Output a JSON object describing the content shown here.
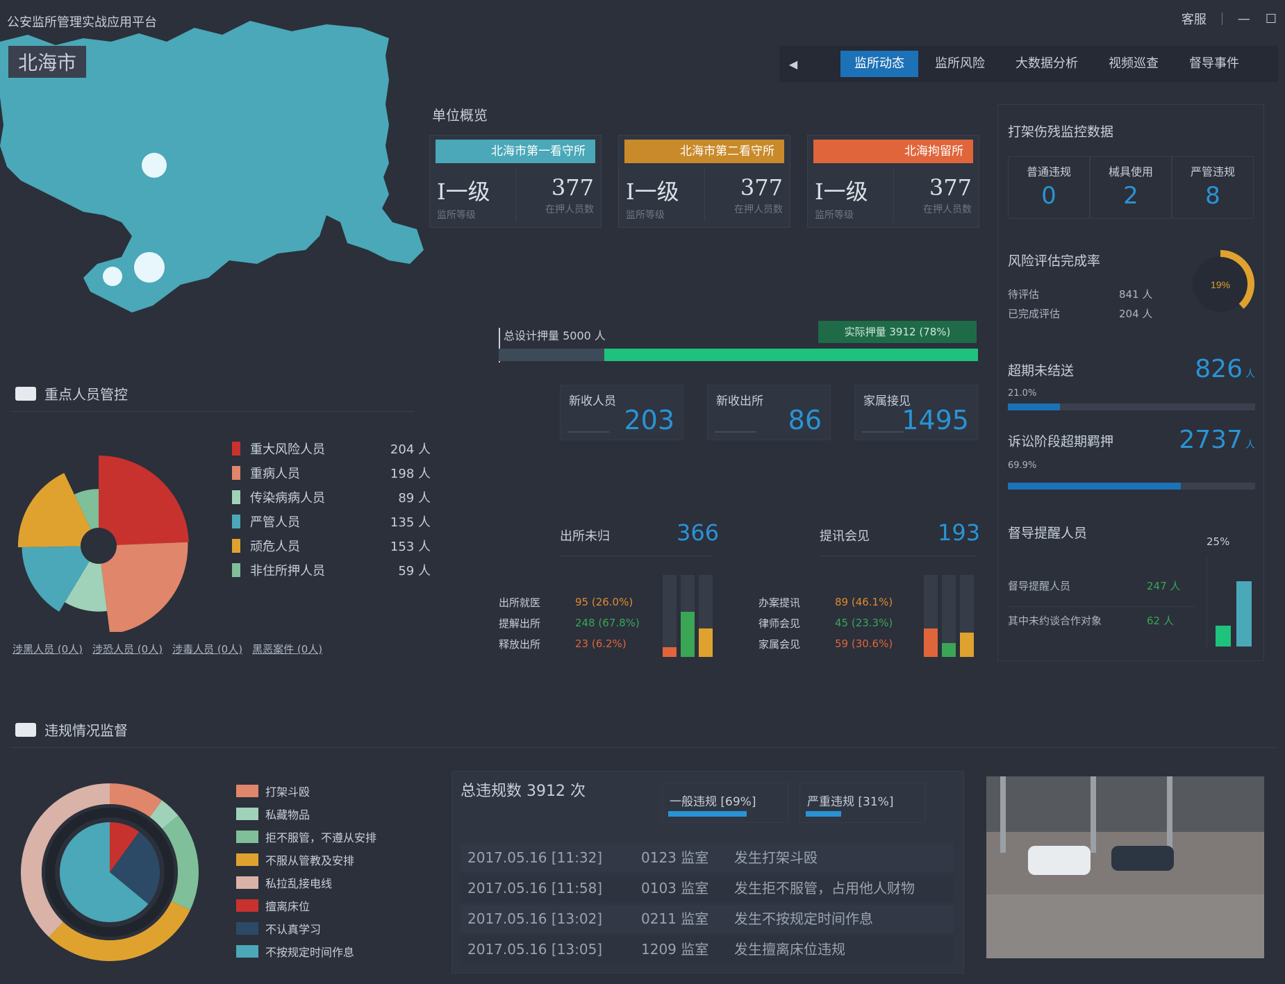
{
  "app": {
    "title": "公安监所管理实战应用平台",
    "city": "北海市"
  },
  "window": {
    "controls": [
      "客服",
      "|",
      "—",
      "☐"
    ]
  },
  "nav": {
    "arrow": "◀",
    "tabs": [
      "监所动态",
      "监所风险",
      "大数据分析",
      "视频巡查",
      "督导事件"
    ],
    "active_index": 0
  },
  "overview": {
    "title": "单位概览",
    "cards": [
      {
        "name": "北海市第一看守所",
        "color": "#4aa8b8",
        "level": "I一级",
        "level_label": "监所等级",
        "count": "377",
        "count_label": "在押人员数"
      },
      {
        "name": "北海市第二看守所",
        "color": "#c88a2a",
        "level": "I一级",
        "level_label": "监所等级",
        "count": "377",
        "count_label": "在押人员数"
      },
      {
        "name": "北海拘留所",
        "color": "#e0653a",
        "level": "I一级",
        "level_label": "监所等级",
        "count": "377",
        "count_label": "在押人员数"
      }
    ]
  },
  "progress": {
    "label": "总设计押量 5000 人",
    "badge": "实际押量 3912 (78%)",
    "fraction": 0.78
  },
  "stats": [
    {
      "label": "新收人员",
      "value": "203"
    },
    {
      "label": "新收出所",
      "value": "86"
    },
    {
      "label": "家属接见",
      "value": "1495"
    }
  ],
  "subpanels": [
    {
      "title": "出所未归",
      "value": "366",
      "rows": [
        {
          "k": "出所就医",
          "v": "95 (26.0%)",
          "color": "#e08a2f"
        },
        {
          "k": "提解出所",
          "v": "248 (67.8%)",
          "color": "#3aa655"
        },
        {
          "k": "释放出所",
          "v": "23 (6.2%)",
          "color": "#e0653a"
        }
      ],
      "bars": [
        {
          "value": 0.12,
          "color": "#e0653a"
        },
        {
          "value": 0.55,
          "color": "#3aa655"
        },
        {
          "value": 0.35,
          "color": "#e0a22f"
        }
      ]
    },
    {
      "title": "提讯会见",
      "value": "193",
      "rows": [
        {
          "k": "办案提讯",
          "v": "89 (46.1%)",
          "color": "#e08a2f"
        },
        {
          "k": "律师会见",
          "v": "45 (23.3%)",
          "color": "#3aa655"
        },
        {
          "k": "家属会见",
          "v": "59 (30.6%)",
          "color": "#e0653a"
        }
      ],
      "bars": [
        {
          "value": 0.35,
          "color": "#e0653a"
        },
        {
          "value": 0.17,
          "color": "#3aa655"
        },
        {
          "value": 0.3,
          "color": "#e0a22f"
        }
      ]
    }
  ],
  "right": {
    "supervision": {
      "title": "打架伤残监控数据",
      "items": [
        {
          "label": "普通违规",
          "value": "0"
        },
        {
          "label": "械具使用",
          "value": "2"
        },
        {
          "label": "严管违规",
          "value": "8"
        }
      ]
    },
    "risk": {
      "title": "风险评估完成率",
      "rows": [
        {
          "k": "待评估",
          "v": "841 人"
        },
        {
          "k": "已完成评估",
          "v": "204 人"
        }
      ],
      "percent_text": "19%",
      "fraction": 0.19
    },
    "metrics": [
      {
        "title": "超期未结送",
        "value": "826",
        "unit": "人",
        "pct": "21.0%",
        "fraction": 0.21
      },
      {
        "title": "诉讼阶段超期羁押",
        "value": "2737",
        "unit": "人",
        "pct": "69.9%",
        "fraction": 0.699
      }
    ],
    "supervise": {
      "title": "督导提醒人员",
      "rows": [
        {
          "k": "督导提醒人员",
          "v": "247 人"
        },
        {
          "k": "其中未约谈合作对象",
          "v": "62 人"
        }
      ],
      "percent_text": "25%",
      "bars": [
        {
          "value": 0.25,
          "color": "#1fc27c"
        },
        {
          "value": 0.78,
          "color": "#4aa8b8"
        }
      ]
    }
  },
  "key_people": {
    "title": "重点人员管控",
    "chart_data": {
      "type": "pie",
      "title": "",
      "categories": [
        "重大风险人员",
        "重病人员",
        "传染病病人员",
        "严管人员",
        "顽危人员",
        "非住所押人员"
      ],
      "values": [
        204,
        198,
        89,
        135,
        153,
        59
      ],
      "counts": [
        "204 人",
        "198 人",
        "89 人",
        "135 人",
        "153 人",
        "59 人"
      ],
      "colors": [
        "#c8322e",
        "#e0866a",
        "#9fd2b8",
        "#4aa8b8",
        "#e0a22f",
        "#7fbf9a"
      ]
    },
    "footer_links": [
      "涉黑人员 (0人)",
      "涉恐人员 (0人)",
      "涉毒人员 (0人)",
      "黑恶案件 (0人)"
    ]
  },
  "violations": {
    "title": "违规情况监督",
    "chart_data": {
      "type": "pie",
      "title": "",
      "categories": [
        "打架斗殴",
        "私藏物品",
        "拒不服管，不遵从安排",
        "不服从管教及安排",
        "私拉乱接电线",
        "擅离床位",
        "不认真学习",
        "不按规定时间作息"
      ],
      "values": [
        10,
        4,
        14,
        30,
        30,
        6,
        14,
        40
      ],
      "colors": [
        "#e0866a",
        "#9fd2b8",
        "#7fbf9a",
        "#e0a22f",
        "#d9b2a8",
        "#c8322e",
        "#2c4a66",
        "#4aa8b8"
      ],
      "outer_values": [
        10,
        4,
        18,
        30,
        38
      ],
      "outer_colors": [
        "#e0866a",
        "#9fd2b8",
        "#7fbf9a",
        "#e0a22f",
        "#d9b2a8"
      ],
      "inner_values": [
        10,
        26,
        64
      ],
      "inner_colors": [
        "#c8322e",
        "#2c4a66",
        "#4aa8b8"
      ]
    }
  },
  "events": {
    "title": "总违规数 3912 次",
    "tabs": [
      {
        "label": "一般违规 [69%]",
        "fraction": 0.69
      },
      {
        "label": "严重违规 [31%]",
        "fraction": 0.31
      }
    ],
    "rows": [
      {
        "time": "2017.05.16 [11:32]",
        "cell": "0123 监室",
        "desc": "发生打架斗殴"
      },
      {
        "time": "2017.05.16 [11:58]",
        "cell": "0103 监室",
        "desc": "发生拒不服管，占用他人财物"
      },
      {
        "time": "2017.05.16 [13:02]",
        "cell": "0211 监室",
        "desc": "发生不按规定时间作息"
      },
      {
        "time": "2017.05.16 [13:05]",
        "cell": "1209 监室",
        "desc": "发生擅离床位违规"
      }
    ]
  }
}
